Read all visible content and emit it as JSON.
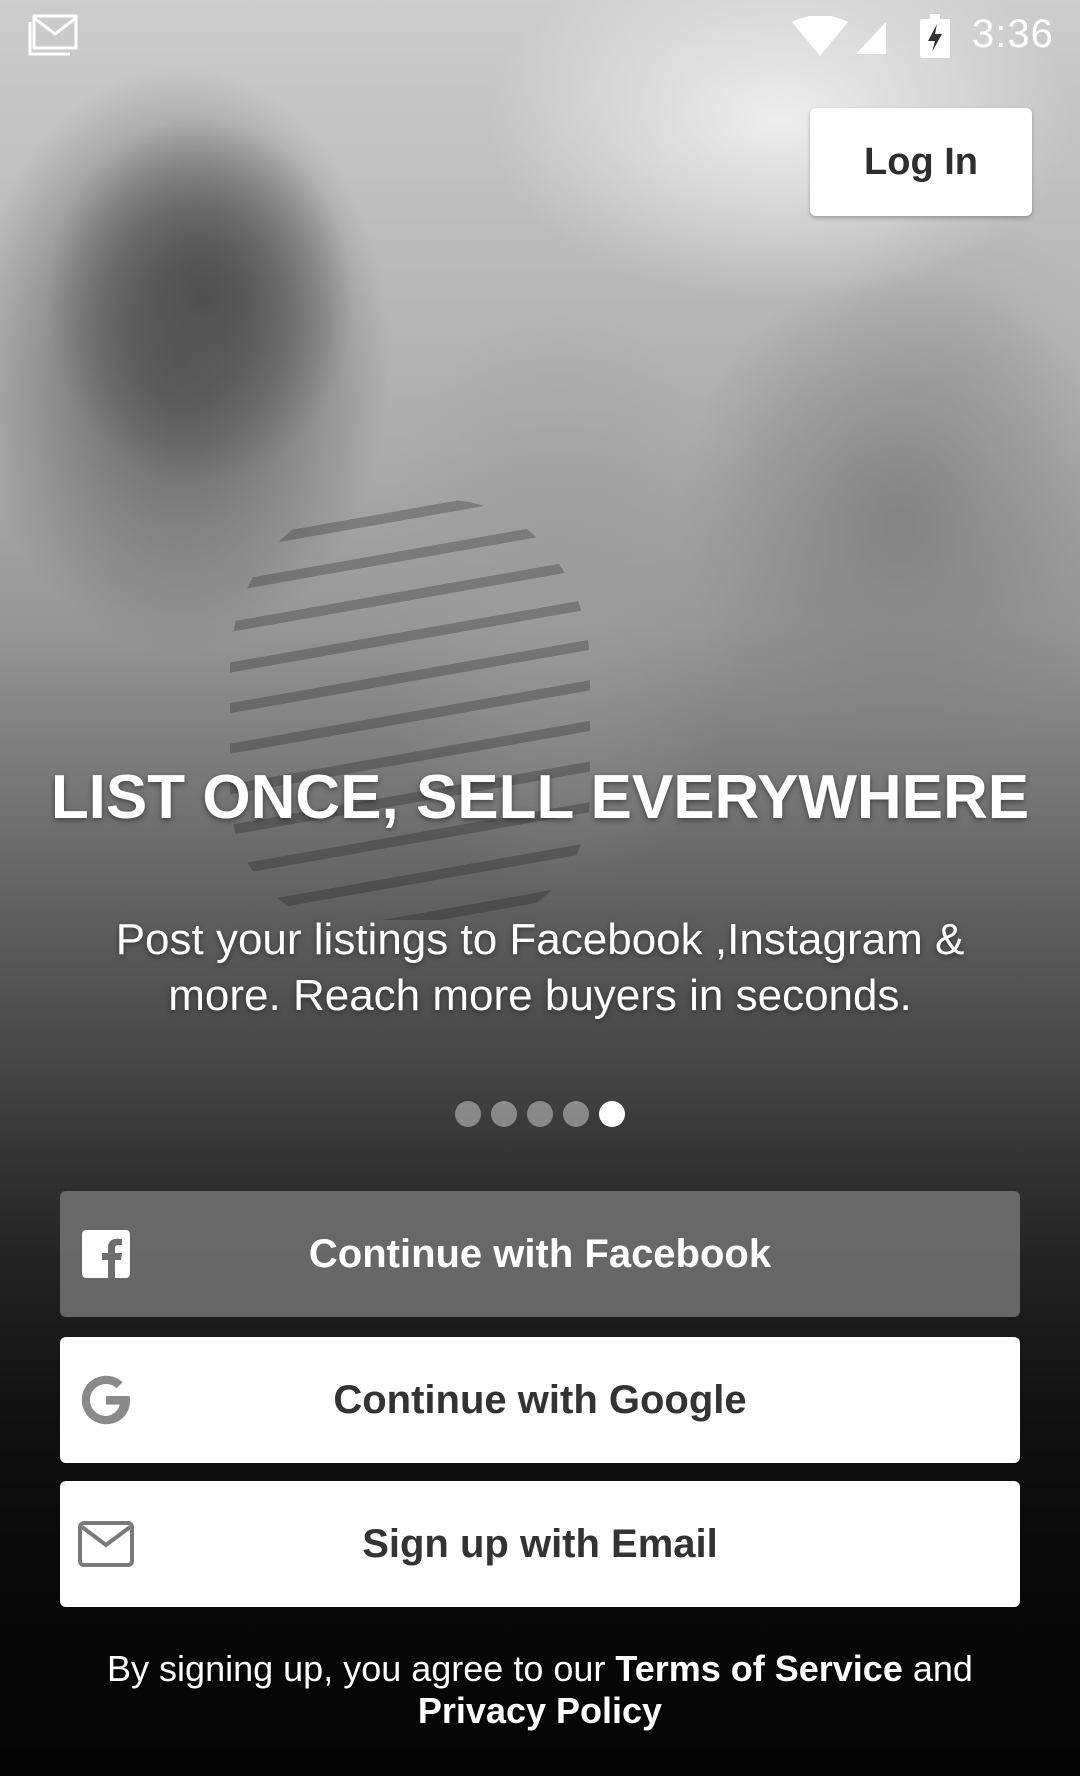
{
  "status_bar": {
    "time": "3:36",
    "icons": [
      "gmail-notification-icon",
      "wifi-icon",
      "cell-signal-icon",
      "battery-charging-icon"
    ]
  },
  "header": {
    "login_label": "Log In"
  },
  "hero": {
    "title": "LIST ONCE, SELL EVERYWHERE",
    "subtitle": "Post your listings to Facebook ,Instagram & more. Reach more buyers in seconds."
  },
  "carousel": {
    "page_count": 5,
    "active_index": 4
  },
  "auth": {
    "facebook_label": "Continue with Facebook",
    "google_label": "Continue with Google",
    "email_label": "Sign up with Email"
  },
  "legal": {
    "prefix": "By signing up, you agree to our ",
    "terms_label": "Terms of Service",
    "connector": " and ",
    "privacy_label": "Privacy Policy"
  },
  "colors": {
    "facebook_button_bg": "#6e6e6e",
    "button_white": "#ffffff",
    "button_text_dark": "#333333",
    "dot_active": "#ffffff",
    "dot_inactive": "#c8c8c8"
  }
}
